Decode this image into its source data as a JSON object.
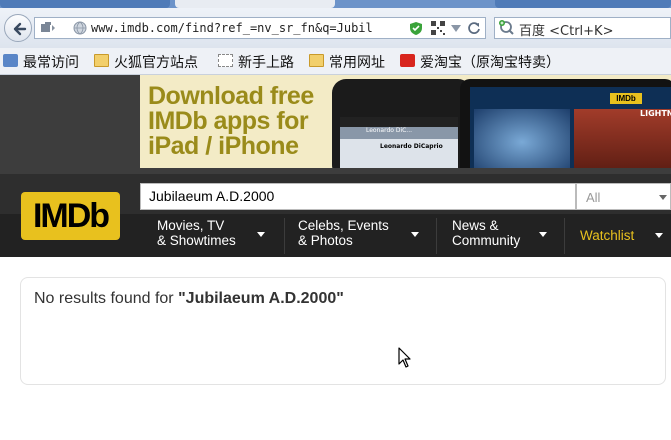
{
  "browser": {
    "url": "www.imdb.com/find?ref_=nv_sr_fn&q=Jubil",
    "search_placeholder": "百度 <Ctrl+K>"
  },
  "bookmarks": [
    {
      "label": "最常访问",
      "icon": "search-folder-icon"
    },
    {
      "label": "火狐官方站点",
      "icon": "folder-icon"
    },
    {
      "label": "新手上路",
      "icon": "page-icon"
    },
    {
      "label": "常用网址",
      "icon": "folder-icon"
    },
    {
      "label": "爱淘宝（原淘宝特卖）",
      "icon": "taobao-icon"
    }
  ],
  "ad": {
    "lines": [
      "Download free",
      "IMDb apps for",
      "iPad / iPhone"
    ],
    "phone_title": "Leonardo DiC...",
    "phone_caption": "Leonardo DiCaprio",
    "tablet_logo": "IMDb",
    "tablet_title": "LIGHTNING I"
  },
  "imdb": {
    "logo": "IMDb",
    "search_value": "Jubilaeum A.D.2000",
    "category": "All",
    "nav": [
      {
        "line1": "Movies, TV",
        "line2": "& Showtimes"
      },
      {
        "line1": "Celebs, Events",
        "line2": "& Photos"
      },
      {
        "line1": "News &",
        "line2": "Community"
      },
      {
        "line1": "Watchlist",
        "line2": ""
      }
    ],
    "results_prefix": "No results found for ",
    "results_query": "\"Jubilaeum A.D.2000\""
  },
  "colors": {
    "imdb_yellow": "#e8c11e",
    "header_dark": "#222222",
    "ad_text": "#9a8b1a"
  }
}
